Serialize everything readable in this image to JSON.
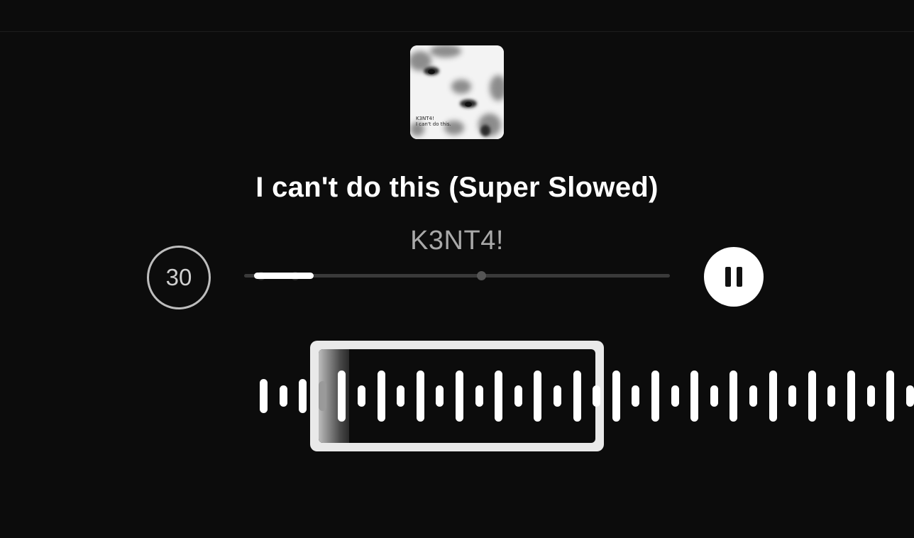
{
  "album": {
    "icon": "album-art-image",
    "art_artist": "K3NT4!",
    "art_track": "I can't do this."
  },
  "track": {
    "title": "I can't do this (Super Slowed)",
    "artist": "K3NT4!"
  },
  "controls": {
    "duration_label": "30",
    "pause_icon": "pause-icon"
  },
  "progress": {
    "fraction": 0.14
  },
  "waveform": {
    "selection_played_fraction": 0.11
  },
  "colors": {
    "background": "#0c0c0c",
    "accent": "#ffffff",
    "muted_text": "#a9a9a9"
  }
}
